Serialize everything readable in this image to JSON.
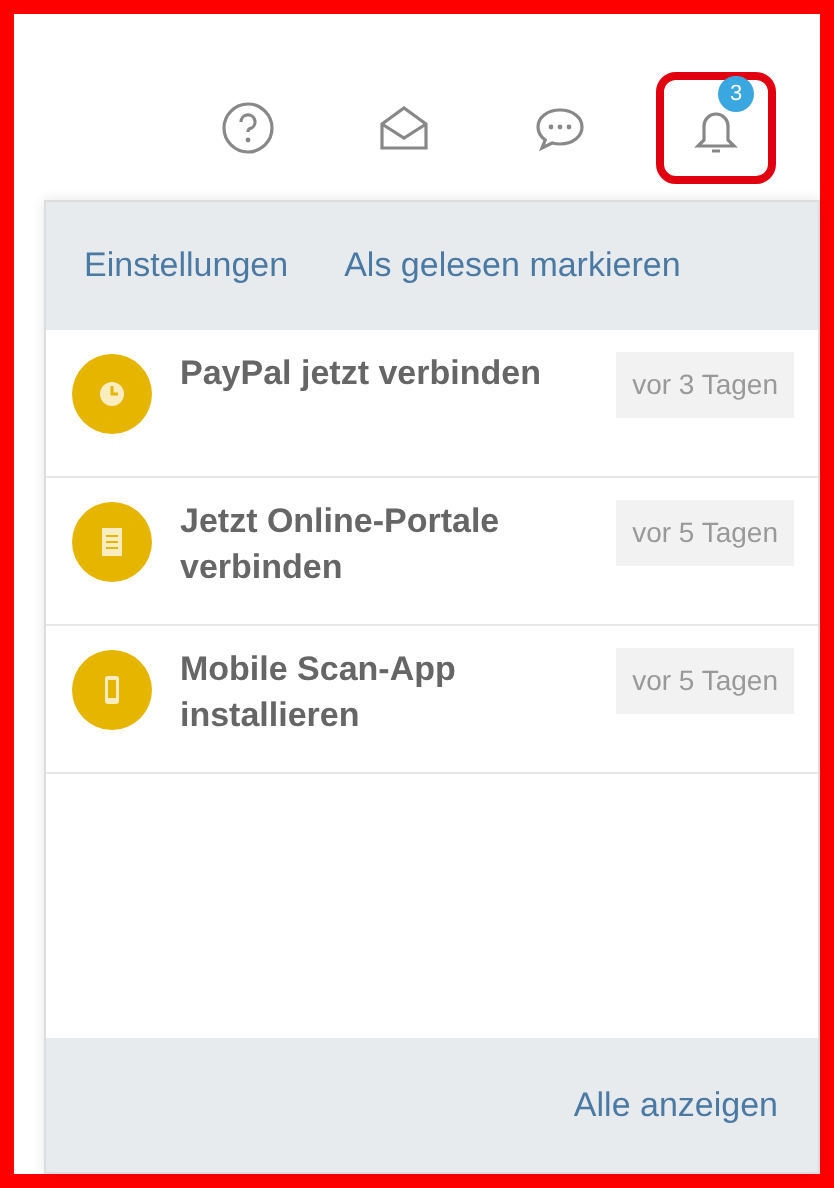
{
  "toolbar": [
    {
      "kind": "help",
      "highlighted": false
    },
    {
      "kind": "mail",
      "highlighted": false
    },
    {
      "kind": "chat",
      "highlighted": false
    },
    {
      "kind": "bell",
      "highlighted": true,
      "badge": "3"
    }
  ],
  "dropdown": {
    "header_links": [
      "Einstellungen",
      "Als gelesen markieren"
    ],
    "notifications": [
      {
        "kind": "clock",
        "title": "PayPal jetzt verbinden",
        "time": "vor 3 Tagen"
      },
      {
        "kind": "document",
        "title": "Jetzt Online-Portale verbinden",
        "time": "vor 5 Tagen"
      },
      {
        "kind": "phone",
        "title": "Mobile Scan-App installieren",
        "time": "vor 5 Tagen"
      }
    ],
    "footer_link": "Alle anzeigen"
  }
}
